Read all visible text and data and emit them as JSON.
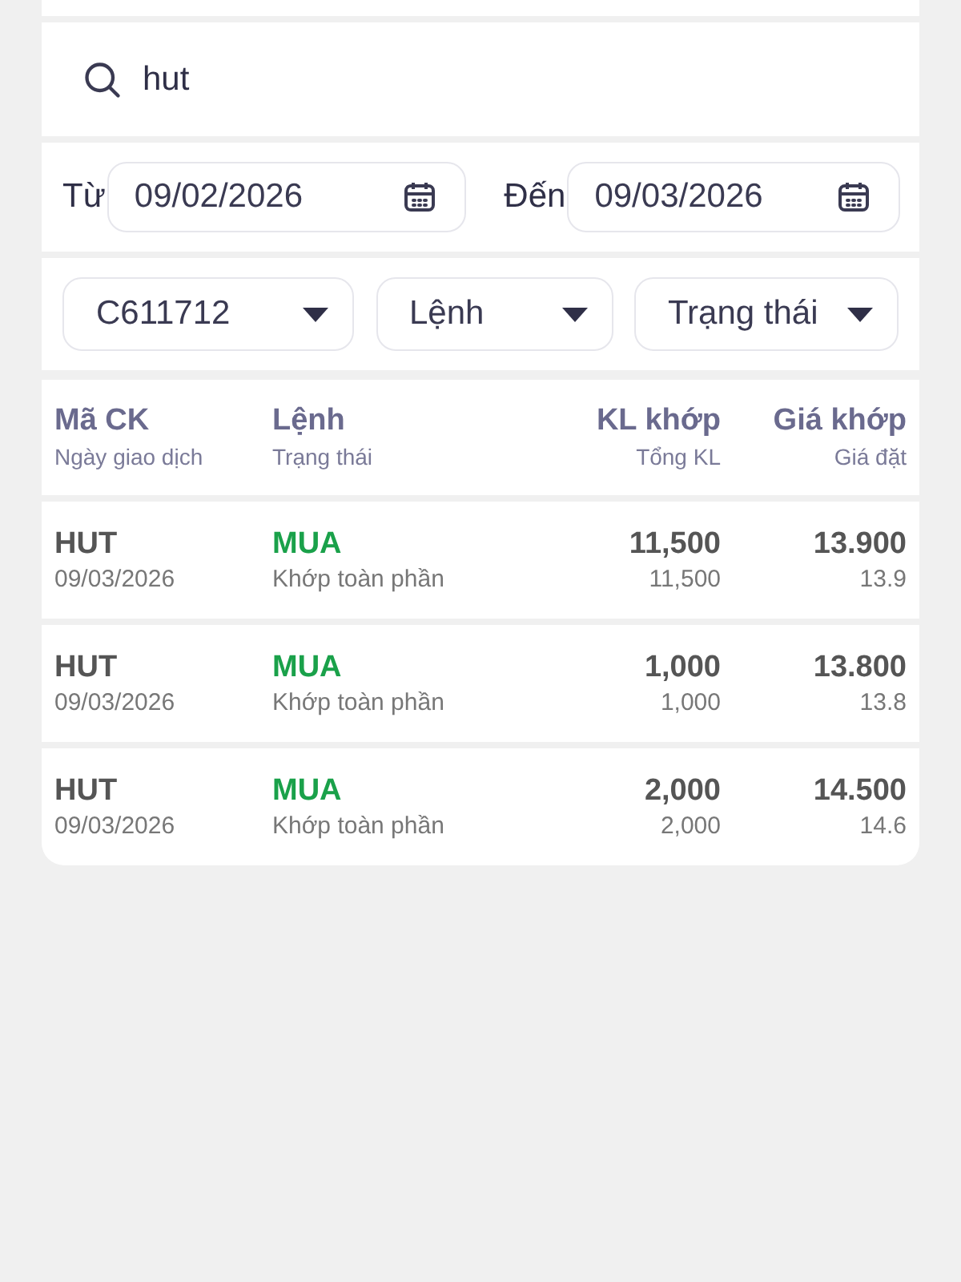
{
  "search": {
    "value": "hut"
  },
  "date_range": {
    "from_label": "Từ",
    "from_value": "09/02/2026",
    "to_label": "Đến",
    "to_value": "09/03/2026"
  },
  "filters": [
    {
      "value": "C611712"
    },
    {
      "value": "Lệnh"
    },
    {
      "value": "Trạng thái"
    }
  ],
  "table": {
    "columns": [
      {
        "title": "Mã CK",
        "subtitle": "Ngày giao dịch"
      },
      {
        "title": "Lệnh",
        "subtitle": "Trạng thái"
      },
      {
        "title": "KL khớp",
        "subtitle": "Tổng KL"
      },
      {
        "title": "Giá khớp",
        "subtitle": "Giá đặt"
      }
    ],
    "rows": [
      {
        "symbol": "HUT",
        "date": "09/03/2026",
        "side": "MUA",
        "color": "#1aa14a",
        "status": "Khớp toàn phần",
        "matched_qty": "11,500",
        "total_qty": "11,500",
        "matched_price": "13.900",
        "order_price": "13.9"
      },
      {
        "symbol": "HUT",
        "date": "09/03/2026",
        "side": "MUA",
        "color": "#1aa14a",
        "status": "Khớp toàn phần",
        "matched_qty": "1,000",
        "total_qty": "1,000",
        "matched_price": "13.800",
        "order_price": "13.8"
      },
      {
        "symbol": "HUT",
        "date": "09/03/2026",
        "side": "MUA",
        "color": "#1aa14a",
        "status": "Khớp toàn phần",
        "matched_qty": "2,000",
        "total_qty": "2,000",
        "matched_price": "14.500",
        "order_price": "14.6"
      }
    ]
  }
}
